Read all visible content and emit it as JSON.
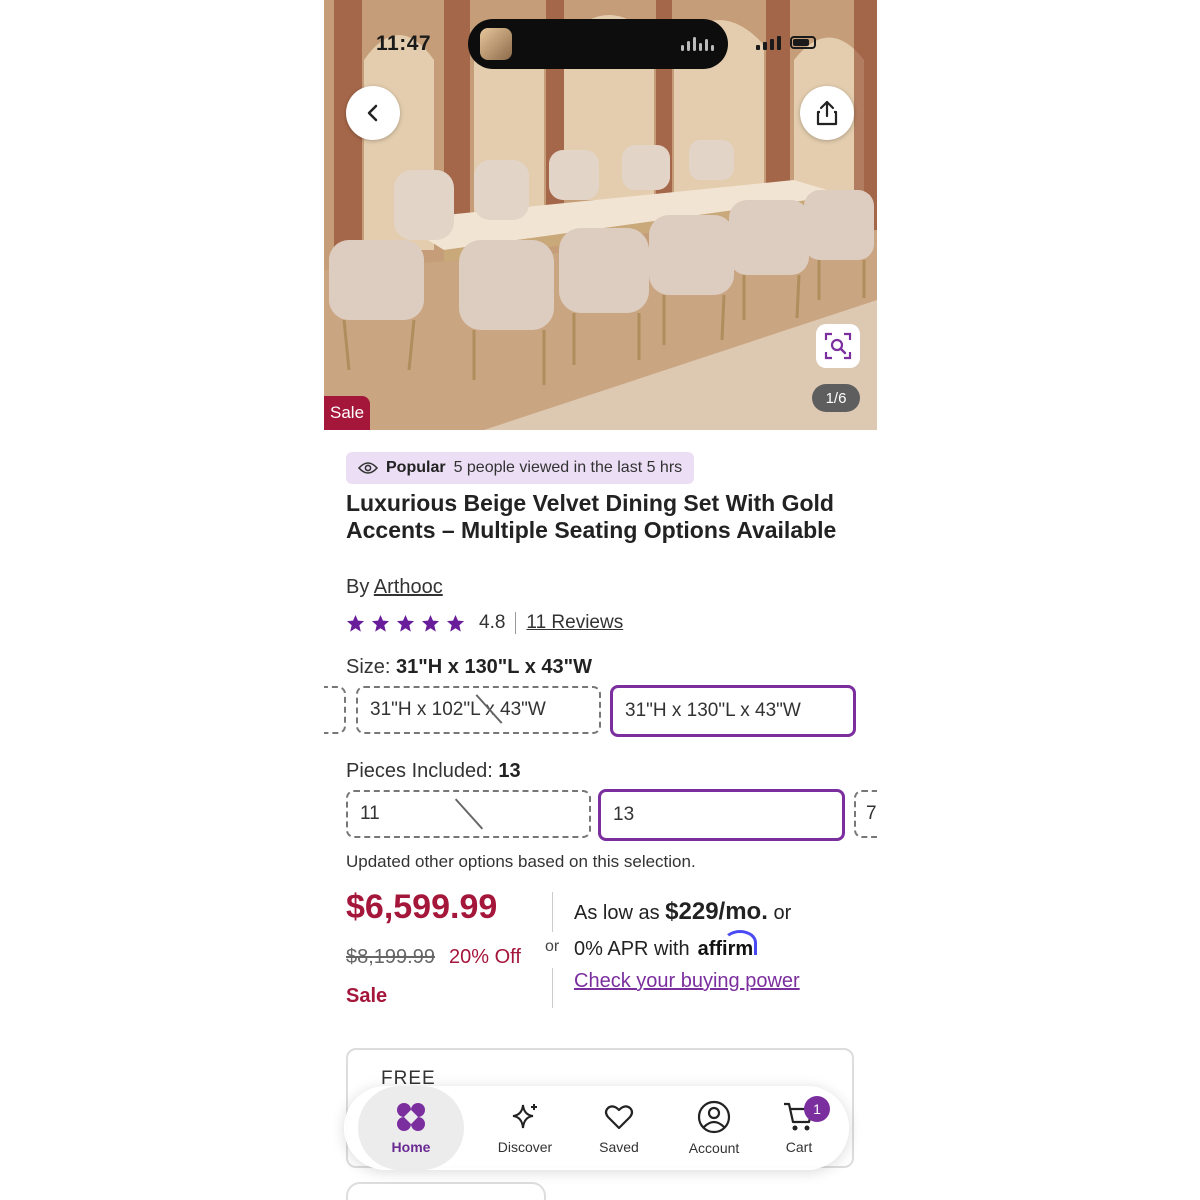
{
  "status": {
    "time": "11:47"
  },
  "gallery": {
    "counter": "1/6",
    "sale_tag": "Sale"
  },
  "popular": {
    "label": "Popular",
    "text": "5 people viewed in the last 5 hrs"
  },
  "product": {
    "title": "Luxurious Beige Velvet Dining Set With Gold Accents – Multiple Seating Options Available",
    "by_prefix": "By",
    "brand": "Arthooc",
    "rating": "4.8",
    "stars": 5,
    "reviews": "11 Reviews"
  },
  "size": {
    "label": "Size:",
    "selected": "31\"H x 130\"L x 43\"W",
    "options": [
      "31\"H x 102\"L x 43\"W",
      "31\"H x 130\"L x 43\"W"
    ]
  },
  "pieces": {
    "label": "Pieces Included:",
    "selected": "13",
    "options": [
      "11",
      "13",
      "7"
    ]
  },
  "note": "Updated other options based on this selection.",
  "pricing": {
    "price": "$6,599.99",
    "was": "$8,199.99",
    "off": "20% Off",
    "sale": "Sale",
    "as_low_as": "As low as",
    "monthly": "$229/mo.",
    "or_small": "or",
    "or_mid": "or",
    "apr": "0% APR with",
    "affirm": "affirm",
    "check": "Check your buying power"
  },
  "shipping": {
    "free": "FREE"
  },
  "tabs": [
    {
      "label": "Home",
      "icon": "home-icon"
    },
    {
      "label": "Discover",
      "icon": "sparkle-icon"
    },
    {
      "label": "Saved",
      "icon": "heart-icon"
    },
    {
      "label": "Account",
      "icon": "account-icon"
    },
    {
      "label": "Cart",
      "icon": "cart-icon",
      "badge": "1"
    }
  ],
  "colors": {
    "accent": "#7b2f9e",
    "sale": "#a5163b",
    "popular_bg": "#ecdff5"
  }
}
